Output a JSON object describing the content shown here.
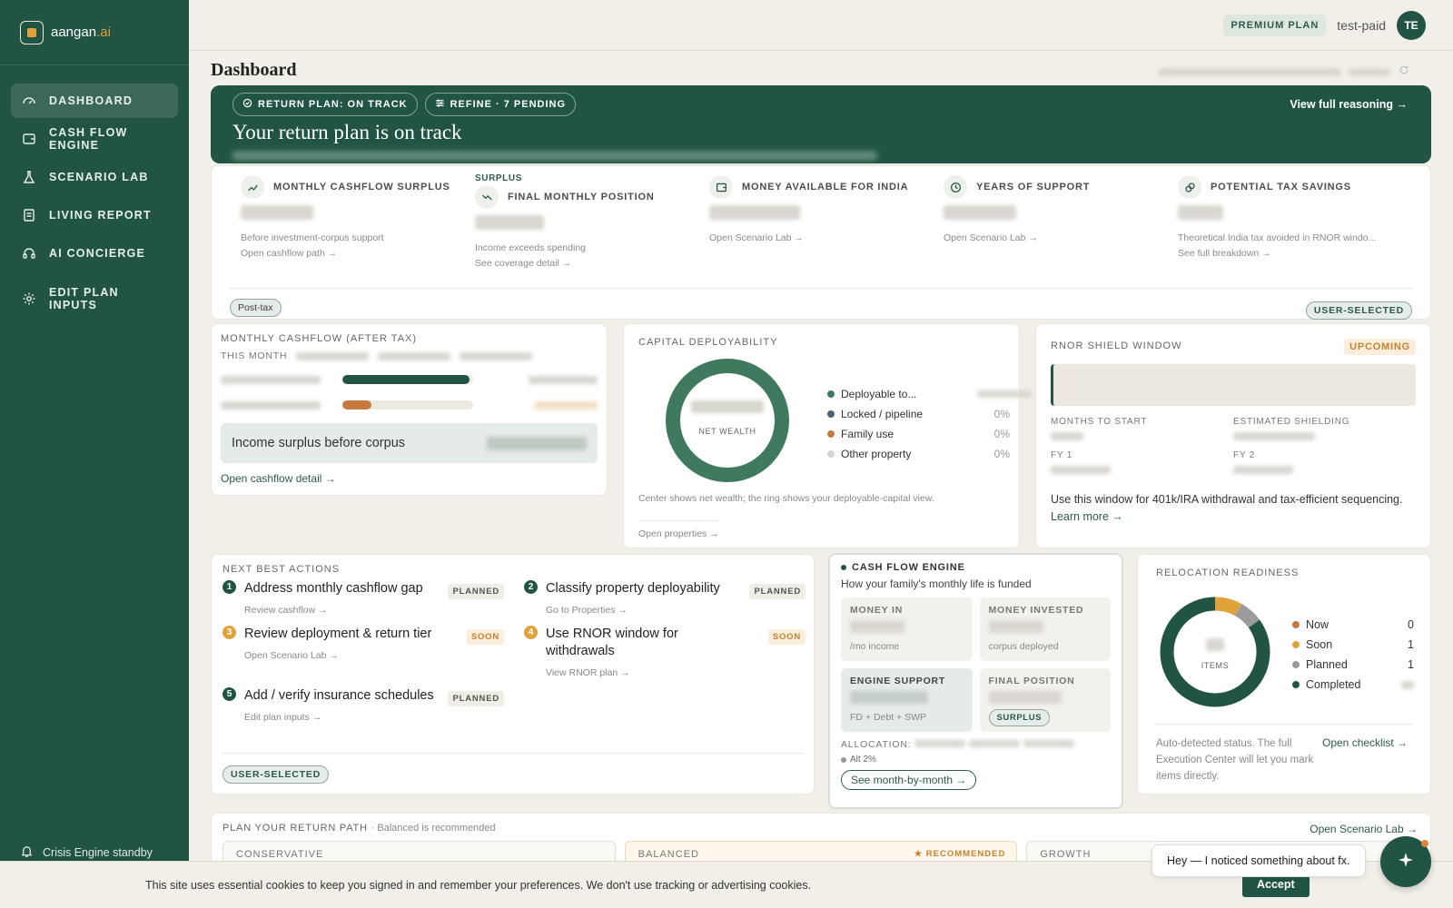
{
  "brand": {
    "name": "aangan",
    "tld": ".ai"
  },
  "nav": [
    {
      "label": "DASHBOARD",
      "icon": "gauge-icon",
      "active": true
    },
    {
      "label": "CASH FLOW ENGINE",
      "icon": "wallet-icon"
    },
    {
      "label": "SCENARIO LAB",
      "icon": "flask-icon"
    },
    {
      "label": "LIVING REPORT",
      "icon": "document-icon"
    },
    {
      "label": "AI CONCIERGE",
      "icon": "headset-icon"
    },
    {
      "label": "EDIT PLAN INPUTS",
      "icon": "gear-icon"
    }
  ],
  "sidebar_footer": "Crisis Engine standby",
  "topbar": {
    "plan": "PREMIUM PLAN",
    "user": "test-paid",
    "initials": "TE"
  },
  "page_title": "Dashboard",
  "hero": {
    "pill1": "RETURN PLAN: ON TRACK",
    "pill2": "REFINE · 7 PENDING",
    "title": "Your return plan is on track",
    "link": "View full reasoning →"
  },
  "metrics": [
    {
      "label": "MONTHLY CASHFLOW SURPLUS",
      "sub": "Before investment-corpus support",
      "link": "Open cashflow path →",
      "icon": "trend-up-icon"
    },
    {
      "pre": "SURPLUS",
      "label": "FINAL MONTHLY POSITION",
      "sub": "Income exceeds spending",
      "link": "See coverage detail →",
      "icon": "trend-down-icon"
    },
    {
      "label": "MONEY AVAILABLE FOR INDIA",
      "sub": "",
      "link": "Open Scenario Lab →",
      "icon": "wallet-icon"
    },
    {
      "label": "YEARS OF SUPPORT",
      "sub": "",
      "link": "Open Scenario Lab →",
      "icon": "clock-icon"
    },
    {
      "label": "POTENTIAL TAX SAVINGS",
      "sub": "Theoretical India tax avoided in RNOR windo...",
      "link": "See full breakdown →",
      "icon": "coins-icon"
    }
  ],
  "metrics_tags": {
    "left": "Post-tax",
    "right": "USER-SELECTED"
  },
  "cashflow": {
    "title": "MONTHLY CASHFLOW (AFTER TAX)",
    "period": "THIS MONTH",
    "bars": [
      {
        "fill": 0.97,
        "color": "#215444"
      },
      {
        "fill": 0.22,
        "color": "#c87a3e"
      }
    ],
    "box_label": "Income surplus before corpus",
    "link": "Open cashflow detail →"
  },
  "capital": {
    "title": "CAPITAL DEPLOYABILITY",
    "center": "NET WEALTH",
    "legend": [
      {
        "name": "Deployable to...",
        "value": "",
        "color": "#3f7a5e"
      },
      {
        "name": "Locked / pipeline",
        "value": "0%",
        "color": "#4f6272"
      },
      {
        "name": "Family use",
        "value": "0%",
        "color": "#c87a3e"
      },
      {
        "name": "Other property",
        "value": "0%",
        "color": "#d5d5d5"
      }
    ],
    "note": "Center shows net wealth; the ring shows your deployable-capital view.",
    "link": "Open properties →"
  },
  "rnor": {
    "title": "RNOR SHIELD WINDOW",
    "status": "UPCOMING",
    "k1": "MONTHS TO START",
    "k2": "ESTIMATED SHIELDING",
    "k3": "FY 1",
    "k4": "FY 2",
    "text": "Use this window for 401k/IRA withdrawal and tax-efficient sequencing.",
    "link": "Learn more →"
  },
  "actions": {
    "title": "NEXT BEST ACTIONS",
    "items": [
      {
        "num": "1",
        "title": "Address monthly cashflow gap",
        "status": "PLANNED",
        "link": "Review cashflow →",
        "color": "#215444"
      },
      {
        "num": "2",
        "title": "Classify property deployability",
        "status": "PLANNED",
        "link": "Go to Properties →",
        "color": "#215444"
      },
      {
        "num": "3",
        "title": "Review deployment & return tier",
        "status": "SOON",
        "link": "Open Scenario Lab →",
        "color": "#e0a23a"
      },
      {
        "num": "4",
        "title": "Use RNOR window for withdrawals",
        "status": "SOON",
        "link": "View RNOR plan →",
        "color": "#e0a23a"
      },
      {
        "num": "5",
        "title": "Add / verify insurance schedules",
        "status": "PLANNED",
        "link": "Edit plan inputs →",
        "color": "#215444"
      }
    ],
    "tag": "USER-SELECTED"
  },
  "engine": {
    "title": "CASH FLOW ENGINE",
    "sub": "How your family's monthly life is funded",
    "c1k": "MONEY IN",
    "c1s": "/mo income",
    "c2k": "MONEY INVESTED",
    "c2s": "corpus deployed",
    "c3k": "ENGINE SUPPORT",
    "c3s": "FD + Debt + SWP",
    "c4k": "FINAL POSITION",
    "c4s": "SURPLUS",
    "alloc": "ALLOCATION:",
    "alt": "Alt 2%",
    "button": "See month-by-month →"
  },
  "reloc": {
    "title": "RELOCATION READINESS",
    "center": "ITEMS",
    "legend": [
      {
        "name": "Now",
        "count": "0",
        "color": "#c87a3e"
      },
      {
        "name": "Soon",
        "count": "1",
        "color": "#e0a23a"
      },
      {
        "name": "Planned",
        "count": "1",
        "color": "#9b9b9b"
      },
      {
        "name": "Completed",
        "count": "",
        "color": "#215444"
      }
    ],
    "ring": [
      {
        "label": "Soon",
        "fraction": 0.08
      },
      {
        "label": "Planned",
        "fraction": 0.07
      },
      {
        "label": "Completed",
        "fraction": 0.85
      }
    ],
    "note": "Auto-detected status. The full Execution Center will let you mark items directly.",
    "link": "Open checklist →"
  },
  "path": {
    "title": "PLAN YOUR RETURN PATH",
    "sub": "· Balanced is recommended",
    "link": "Open Scenario Lab →",
    "cols": [
      "CONSERVATIVE",
      "BALANCED",
      "GROWTH"
    ],
    "rec": "★ RECOMMENDED"
  },
  "cookie": {
    "text": "This site uses essential cookies to keep you signed in and remember your preferences. We don't use tracking or advertising cookies.",
    "button": "Accept"
  },
  "toast": "Hey — I noticed something about fx."
}
